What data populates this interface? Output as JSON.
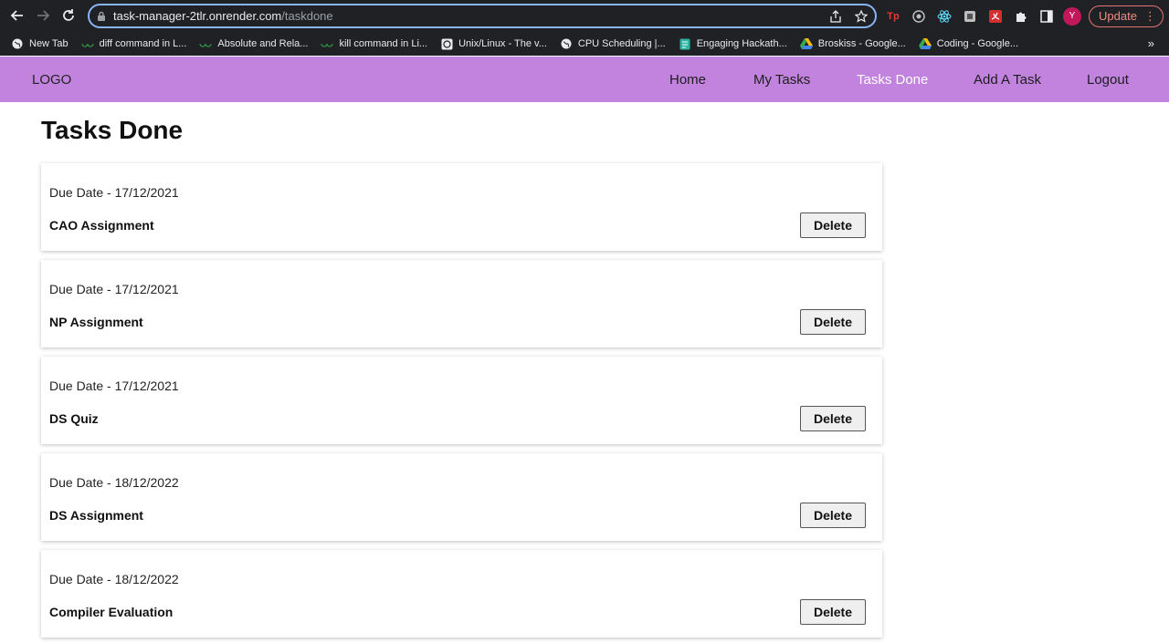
{
  "browser": {
    "url_host": "task-manager-2tlr.onrender.com",
    "url_path": "/taskdone",
    "update_label": "Update",
    "avatar_letter": "Y",
    "bookmarks": [
      {
        "label": "New Tab",
        "icon": "globe-icon"
      },
      {
        "label": "diff command in L...",
        "icon": "gfg-icon"
      },
      {
        "label": "Absolute and Rela...",
        "icon": "gfg-icon"
      },
      {
        "label": "kill command in Li...",
        "icon": "gfg-icon"
      },
      {
        "label": "Unix/Linux - The v...",
        "icon": "chatgpt-icon"
      },
      {
        "label": "CPU Scheduling |...",
        "icon": "globe-icon"
      },
      {
        "label": "Engaging Hackath...",
        "icon": "doc-icon"
      },
      {
        "label": "Broskiss - Google...",
        "icon": "drive-icon"
      },
      {
        "label": "Coding - Google...",
        "icon": "drive-icon"
      }
    ],
    "colors": {
      "chrome": "#202124",
      "focus": "#8ab4f8"
    }
  },
  "app": {
    "logo": "LOGO",
    "nav": [
      {
        "label": "Home",
        "active": false
      },
      {
        "label": "My Tasks",
        "active": false
      },
      {
        "label": "Tasks Done",
        "active": true
      },
      {
        "label": "Add A Task",
        "active": false
      },
      {
        "label": "Logout",
        "active": false
      }
    ],
    "nav_color": "#c283df",
    "page_title": "Tasks Done",
    "delete_label": "Delete",
    "tasks": [
      {
        "due": "Due Date - 17/12/2021",
        "name": "CAO Assignment"
      },
      {
        "due": "Due Date - 17/12/2021",
        "name": "NP Assignment"
      },
      {
        "due": "Due Date - 17/12/2021",
        "name": "DS Quiz"
      },
      {
        "due": "Due Date - 18/12/2022",
        "name": "DS Assignment"
      },
      {
        "due": "Due Date - 18/12/2022",
        "name": "Compiler Evaluation"
      }
    ]
  }
}
